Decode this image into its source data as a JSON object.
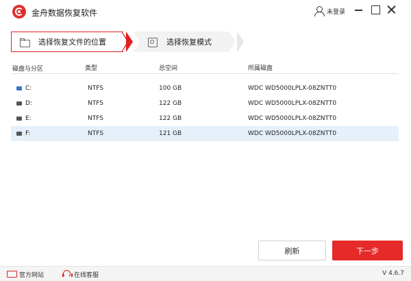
{
  "app": {
    "title": "金舟数据恢复软件"
  },
  "user": {
    "label": "未登录"
  },
  "steps": [
    {
      "label": "选择恢复文件的位置",
      "icon": "folder-icon",
      "active": true
    },
    {
      "label": "选择恢复模式",
      "icon": "disk-mode-icon",
      "active": false
    }
  ],
  "table": {
    "headers": [
      "磁盘与分区",
      "类型",
      "总空间",
      "所属磁盘"
    ],
    "rows": [
      {
        "name": "C:",
        "type": "NTFS",
        "size": "100 GB",
        "disk": "WDC WD5000LPLX-08ZNTT0",
        "icon": "system-drive-icon",
        "selected": false
      },
      {
        "name": "D:",
        "type": "NTFS",
        "size": "122 GB",
        "disk": "WDC WD5000LPLX-08ZNTT0",
        "icon": "drive-icon",
        "selected": false
      },
      {
        "name": "E:",
        "type": "NTFS",
        "size": "122 GB",
        "disk": "WDC WD5000LPLX-08ZNTT0",
        "icon": "drive-icon",
        "selected": false
      },
      {
        "name": "F:",
        "type": "NTFS",
        "size": "121 GB",
        "disk": "WDC WD5000LPLX-08ZNTT0",
        "icon": "drive-icon",
        "selected": true
      }
    ]
  },
  "buttons": {
    "refresh": "刷新",
    "next": "下一步"
  },
  "status": {
    "site": "官方网站",
    "service": "在线客服",
    "version": "V 4.6.7"
  },
  "colors": {
    "accent": "#e62929",
    "selected_row": "#e6f0fa",
    "system_drive": "#3a78c2"
  }
}
